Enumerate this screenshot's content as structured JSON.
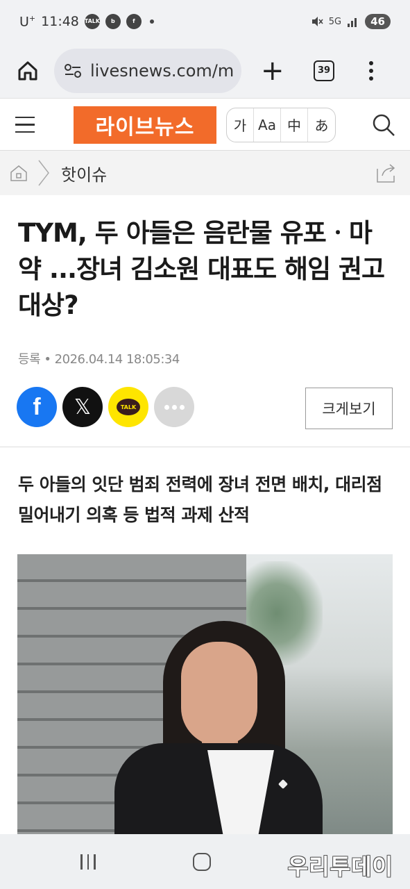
{
  "status_bar": {
    "carrier": "U",
    "carrier_sup": "+",
    "time": "11:48",
    "notif_talk_label": "TALK",
    "network": "5G",
    "battery": "46"
  },
  "browser": {
    "url": "livesnews.com/m",
    "tab_count": "39"
  },
  "site": {
    "logo_text": "라이브뉴스",
    "lang_options": [
      "가",
      "Aa",
      "中",
      "あ"
    ]
  },
  "breadcrumb": {
    "section": "핫이슈"
  },
  "article": {
    "headline": "TYM, 두 아들은 음란물 유포ㆍ마약 ...장녀 김소원 대표도 해임 권고 대상?",
    "date_line": "등록 • 2026.04.14 18:05:34",
    "enlarge_label": "크게보기",
    "subheadline": "두 아들의 잇단 범죄 전력에 장녀 전면 배치, 대리점 밀어내기 의혹 등 법적 과제 산적",
    "kakao_label": "TALK",
    "facebook_letter": "f",
    "x_letter": "𝕏"
  },
  "watermark": "우리투데이",
  "colors": {
    "logo_bg": "#f26b2a",
    "facebook": "#1877f2",
    "kakao": "#fee500",
    "x": "#111111"
  }
}
